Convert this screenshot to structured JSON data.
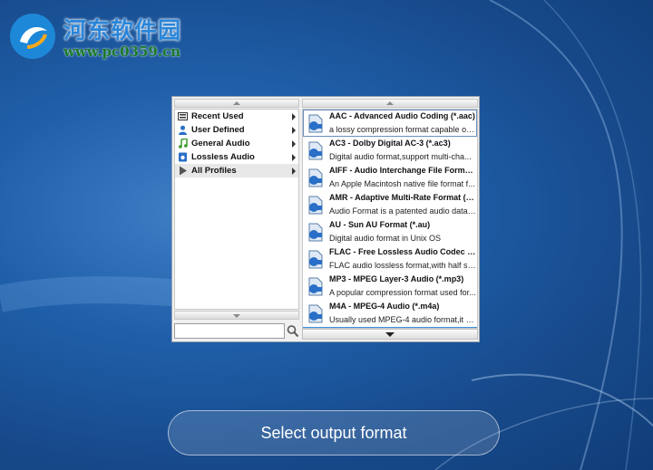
{
  "watermark": {
    "title": "河东软件园",
    "url": "www.pc0359.cn"
  },
  "categories": [
    {
      "label": "Recent Used",
      "icon": "recent-icon",
      "active": false
    },
    {
      "label": "User Defined",
      "icon": "user-icon",
      "active": false
    },
    {
      "label": "General Audio",
      "icon": "music-note-icon",
      "active": false
    },
    {
      "label": "Lossless Audio",
      "icon": "lossless-icon",
      "active": false
    },
    {
      "label": "All Profiles",
      "icon": "play-profile-icon",
      "active": true
    }
  ],
  "search": {
    "value": "",
    "placeholder": ""
  },
  "formats": [
    {
      "name": "AAC - Advanced Audio Coding (*.aac)",
      "desc": "a lossy compression format capable of ...",
      "badge": "AAC",
      "selected": true
    },
    {
      "name": "AC3 - Dolby Digital AC-3 (*.ac3)",
      "desc": "Digital audio format,support multi-cha...",
      "badge": "AC3",
      "selected": false
    },
    {
      "name": "AIFF - Audio Interchange File Format ...",
      "desc": "An Apple Macintosh native file format f...",
      "badge": "AIFF",
      "selected": false
    },
    {
      "name": "AMR - Adaptive Multi-Rate Format (*....",
      "desc": "Audio Format is a patented audio data ...",
      "badge": "AMR",
      "selected": false
    },
    {
      "name": "AU - Sun AU Format (*.au)",
      "desc": "Digital audio format in Unix OS",
      "badge": "AU",
      "selected": false
    },
    {
      "name": "FLAC - Free Lossless Audio Codec (*.fl...",
      "desc": "FLAC audio lossless format,with half siz...",
      "badge": "FLAC",
      "selected": false
    },
    {
      "name": "MP3 - MPEG Layer-3 Audio (*.mp3)",
      "desc": "A popular compression format used for...",
      "badge": "MP3",
      "selected": false
    },
    {
      "name": "M4A - MPEG-4 Audio (*.m4a)",
      "desc": "Usually used MPEG-4 audio format,it c...",
      "badge": "M4A",
      "selected": false
    }
  ],
  "caption": "Select output format",
  "colors": {
    "accent": "#3d8fe0",
    "background": "#1f5fa9"
  }
}
